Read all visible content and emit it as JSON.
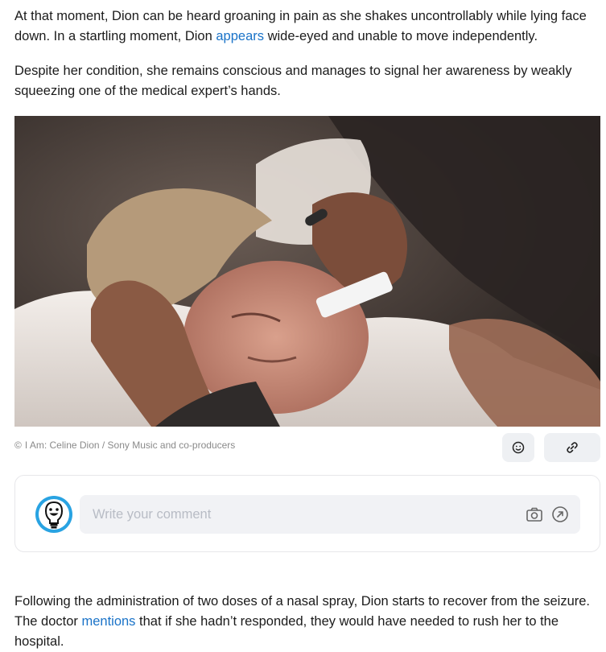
{
  "article": {
    "p1": {
      "before": "At that moment, Dion can be heard groaning in pain as she shakes uncontrollably while lying face down. In a startling moment, Dion ",
      "link": "appears",
      "after": " wide-eyed and unable to move independently."
    },
    "p2": "Despite her condition, she remains conscious and manages to signal her awareness by weakly squeezing one of the medical expert’s hands.",
    "p3": {
      "before": "Following the administration of two doses of a nasal spray, Dion starts to recover from the seizure. The doctor ",
      "link": "mentions",
      "after": " that if she hadn’t responded, they would have needed to rush her to the hospital."
    }
  },
  "photo": {
    "credit_symbol": "©",
    "credit_text": "I Am: Celine Dion / Sony Music and co-producers"
  },
  "actions": {
    "react_icon": "smiley-icon",
    "link_icon": "link-icon"
  },
  "comment": {
    "placeholder": "Write your comment",
    "avatar_icon": "lightbulb-smiley-icon",
    "camera_icon": "camera-icon",
    "submit_icon": "arrow-up-right-circle-icon"
  },
  "colors": {
    "link": "#1a73c8",
    "avatar_ring": "#29a3e2",
    "button_bg": "#eef0f3",
    "input_bg": "#f1f2f5"
  }
}
